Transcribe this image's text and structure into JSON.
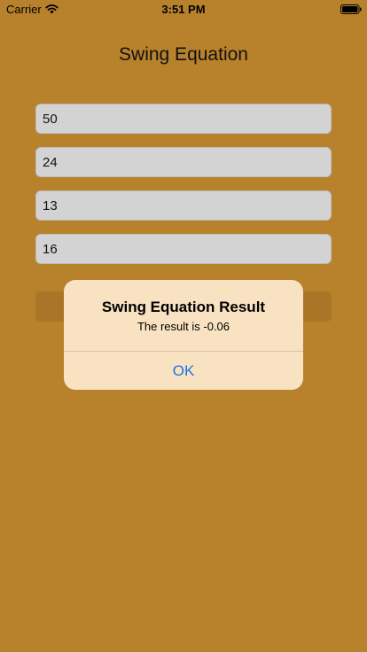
{
  "status_bar": {
    "carrier": "Carrier",
    "time": "3:51 PM"
  },
  "screen": {
    "title": "Swing Equation",
    "background_color": "#b8812c",
    "fields": [
      {
        "value": "50"
      },
      {
        "value": "24"
      },
      {
        "value": "13"
      },
      {
        "value": "16"
      }
    ]
  },
  "alert": {
    "title": "Swing Equation Result",
    "message": "The result is -0.06",
    "ok_label": "OK",
    "button_color": "#1a73e8",
    "background_color": "#f9e2c1"
  }
}
